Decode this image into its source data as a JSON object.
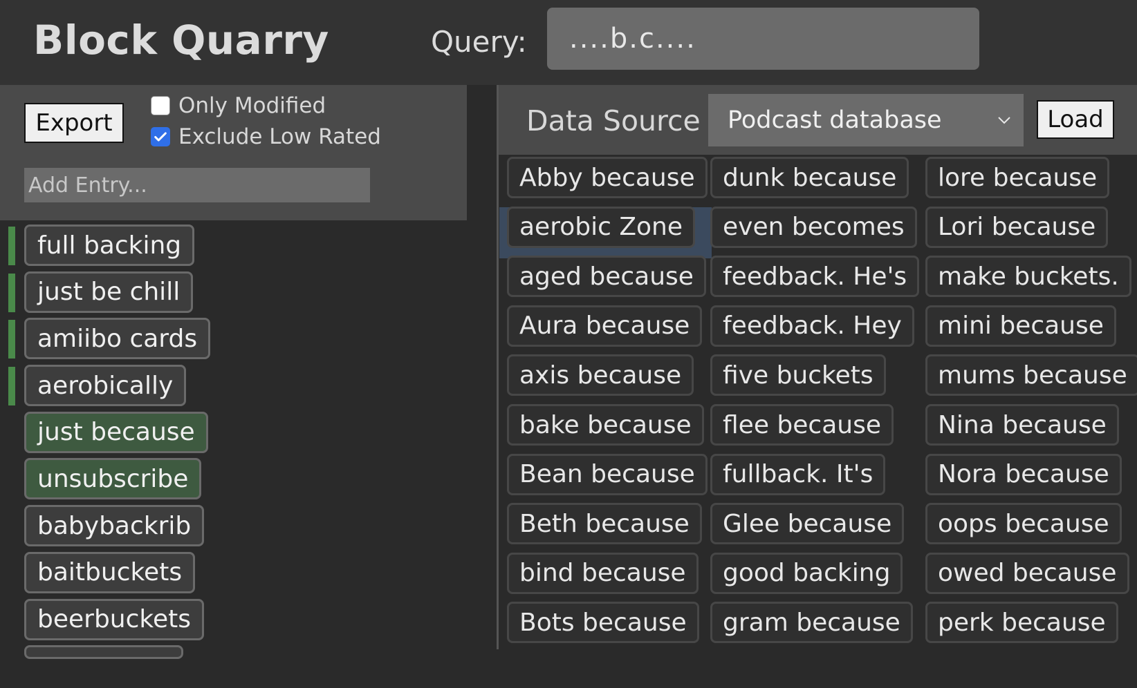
{
  "header": {
    "title": "Block Quarry",
    "query_label": "Query:",
    "query_value": "....b.c...."
  },
  "left": {
    "export_label": "Export",
    "only_modified": {
      "label": "Only Modified",
      "checked": false
    },
    "exclude_low_rated": {
      "label": "Exclude Low Rated",
      "checked": true
    },
    "add_entry_placeholder": "Add Entry...",
    "entries": [
      {
        "text": "full backing",
        "marked": true,
        "style": "default"
      },
      {
        "text": "just be chill",
        "marked": true,
        "style": "default"
      },
      {
        "text": "amiibo cards",
        "marked": true,
        "style": "default"
      },
      {
        "text": "aerobically",
        "marked": true,
        "style": "default"
      },
      {
        "text": "just because",
        "marked": false,
        "style": "green"
      },
      {
        "text": "unsubscribe",
        "marked": false,
        "style": "green"
      },
      {
        "text": "babybackrib",
        "marked": false,
        "style": "default"
      },
      {
        "text": "baitbuckets",
        "marked": false,
        "style": "default"
      },
      {
        "text": "beerbuckets",
        "marked": false,
        "style": "default"
      }
    ]
  },
  "right": {
    "source_label": "Data Source",
    "source_value": "Podcast database",
    "load_label": "Load",
    "selected_result": "aerobic Zone",
    "columns": [
      [
        "Abby because",
        "aerobic Zone",
        "aged because",
        "Aura because",
        "axis because",
        "bake because",
        "Bean because",
        "Beth because",
        "bind because",
        "Bots because"
      ],
      [
        "dunk because",
        "even becomes",
        "feedback. He's",
        "feedback. Hey",
        "five buckets",
        "flee because",
        "fullback. It's",
        "Glee because",
        "good backing",
        "gram because"
      ],
      [
        "lore because",
        "Lori because",
        "make buckets.",
        "mini because",
        "mums because",
        "Nina because",
        "Nora because",
        "oops because",
        "owed because",
        "perk because"
      ]
    ]
  },
  "colors": {
    "background": "#2a2a2a",
    "panel": "#4a4a4a",
    "input": "#6b6b6b",
    "marker_green": "#4a8a4a",
    "chip_green": "#3e5a40",
    "selection_blue": "#3b4a5e",
    "checkbox_blue": "#2f6fe8"
  }
}
